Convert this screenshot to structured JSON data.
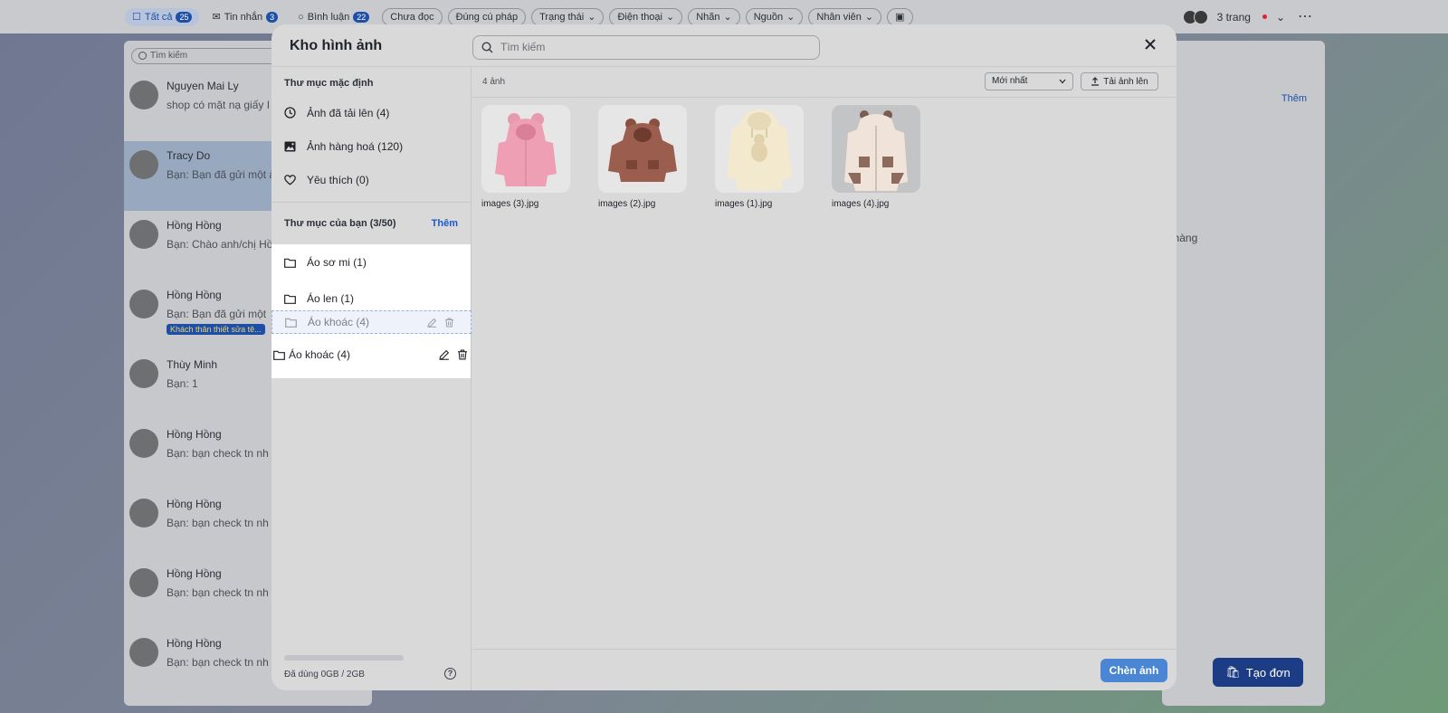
{
  "background": {
    "tabs": [
      {
        "label": "Tất cả",
        "count": "25"
      },
      {
        "label": "Tin nhắn",
        "count": "3"
      },
      {
        "label": "Bình luận",
        "count": "22"
      }
    ],
    "filters": [
      "Chưa đọc",
      "Đúng cú pháp",
      "Trạng thái",
      "Điện thoại",
      "Nhãn",
      "Nguồn",
      "Nhân viên"
    ],
    "pages_label": "3 trang",
    "search_placeholder": "Tìm kiếm",
    "conversations": [
      {
        "name": "Nguyen Mai Ly",
        "message": "shop có mặt nạ giấy I"
      },
      {
        "name": "Tracy Do",
        "message": "Bạn: Bạn đã gửi một ả"
      },
      {
        "name": "Hồng Hồng",
        "message": "Bạn: Chào anh/chị Hồ"
      },
      {
        "name": "Hồng Hồng",
        "message": "Bạn: Bạn đã gửi một",
        "tag": "Khách thân thiết sửa tê..."
      },
      {
        "name": "Thùy Minh",
        "message": "Bạn: 1"
      },
      {
        "name": "Hồng Hồng",
        "message": "Bạn: bạn check tn nh"
      },
      {
        "name": "Hồng Hồng",
        "message": "Bạn: bạn check tn nh"
      },
      {
        "name": "Hồng Hồng",
        "message": "Bạn: bạn check tn nh"
      },
      {
        "name": "Hồng Hồng",
        "message": "Bạn: bạn check tn nh"
      }
    ],
    "right_add": "Thêm",
    "right_text": "đơn hàng",
    "create_order": "Tạo đơn"
  },
  "modal": {
    "title": "Kho hình ảnh",
    "search_placeholder": "Tìm kiếm",
    "default_folders_title": "Thư mục mặc định",
    "default_folders": [
      {
        "label": "Ảnh đã tải lên (4)",
        "icon": "clock-icon"
      },
      {
        "label": "Ảnh hàng hoá (120)",
        "icon": "image-icon"
      },
      {
        "label": "Yêu thích (0)",
        "icon": "heart-icon"
      }
    ],
    "your_folders_title": "Thư mục của bạn (3/50)",
    "your_folders_add": "Thêm",
    "your_folders": [
      {
        "label": "Áo sơ mi (1)"
      },
      {
        "label": "Áo len (1)"
      }
    ],
    "ghost_folder": "Áo khoác (4)",
    "dragging_folder": "Áo khoác (4)",
    "storage_text": "Đã dùng 0GB / 2GB",
    "storage_used_fraction": 0,
    "image_count": "4 ảnh",
    "sort_value": "Mới nhất",
    "upload_label": "Tải ảnh lên",
    "images": [
      {
        "name": "images (3).jpg"
      },
      {
        "name": "images (2).jpg"
      },
      {
        "name": "images (1).jpg"
      },
      {
        "name": "images (4).jpg"
      }
    ],
    "insert_label": "Chèn ảnh"
  },
  "colors": {
    "accent": "#1d58c8",
    "insert_button": "#4a86d4",
    "create_order_button": "#1c3d86"
  }
}
